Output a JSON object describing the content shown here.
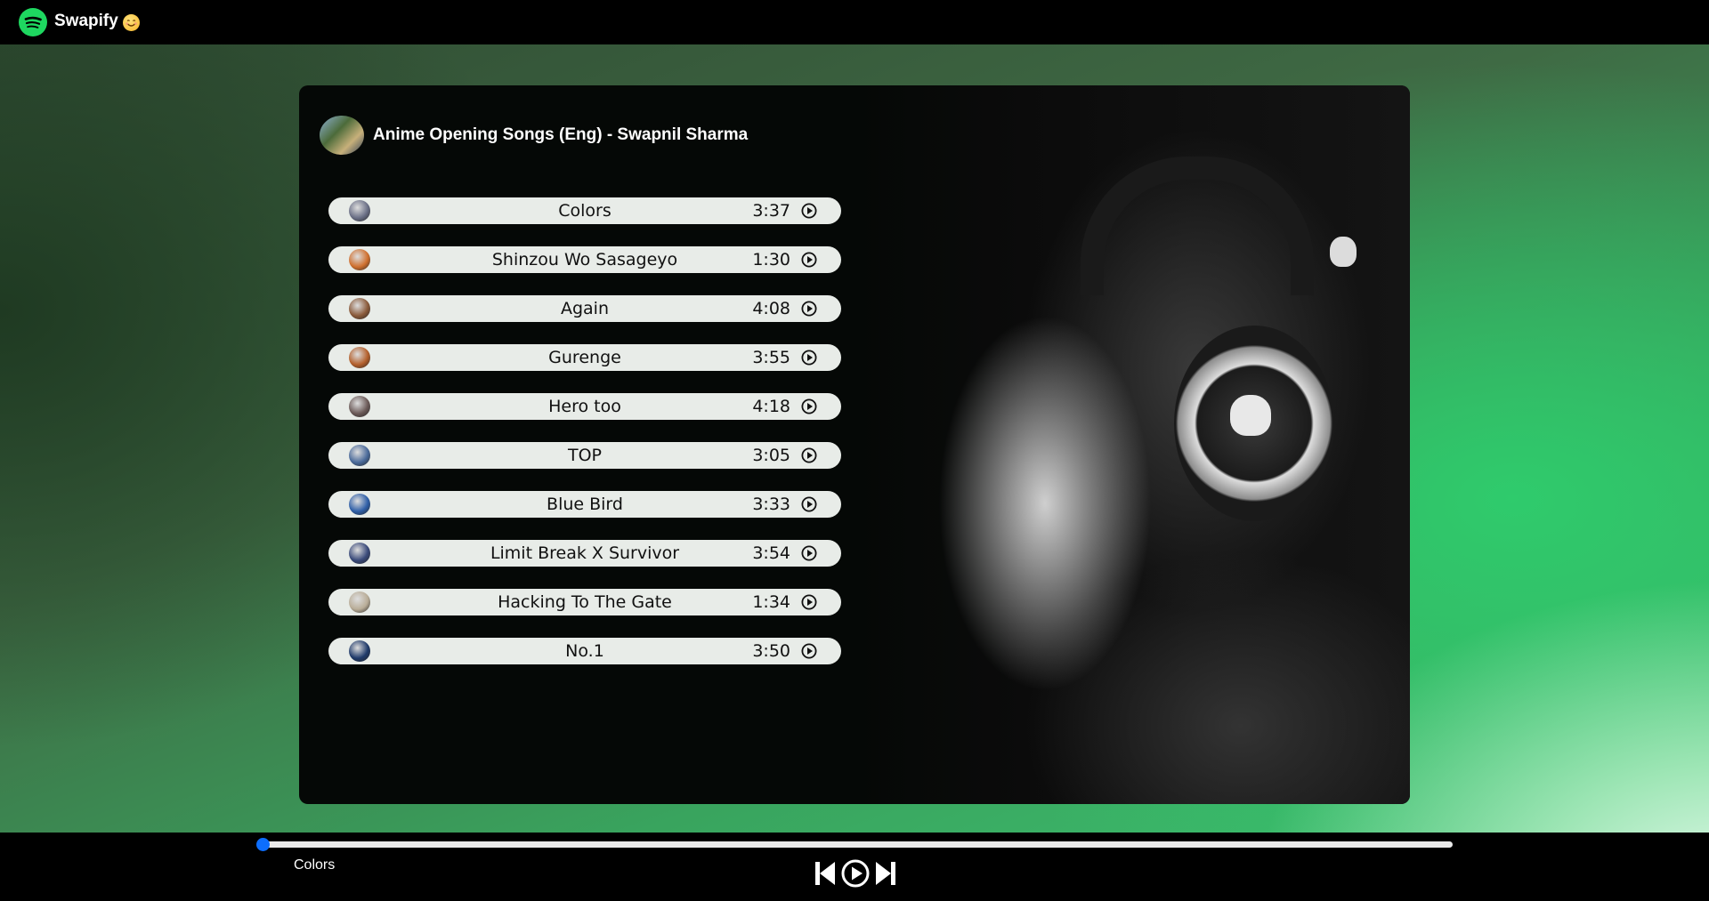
{
  "header": {
    "brand": "Swapify",
    "logo_icon": "spotify-logo-icon",
    "emoji_icon": "smiling-face-icon"
  },
  "playlist": {
    "title": "Anime Opening Songs (Eng) - Swapnil Sharma",
    "songs": [
      {
        "name": "Colors",
        "duration": "3:37",
        "thumb_color": "#6a6f86"
      },
      {
        "name": "Shinzou Wo Sasageyo",
        "duration": "1:30",
        "thumb_color": "#d0702f"
      },
      {
        "name": "Again",
        "duration": "4:08",
        "thumb_color": "#8a5a3a"
      },
      {
        "name": "Gurenge",
        "duration": "3:55",
        "thumb_color": "#b4602c"
      },
      {
        "name": "Hero too",
        "duration": "4:18",
        "thumb_color": "#6b5a58"
      },
      {
        "name": "TOP",
        "duration": "3:05",
        "thumb_color": "#4a6a9a"
      },
      {
        "name": "Blue Bird",
        "duration": "3:33",
        "thumb_color": "#2f5fa8"
      },
      {
        "name": "Limit Break X Survivor",
        "duration": "3:54",
        "thumb_color": "#3a4a7a"
      },
      {
        "name": "Hacking To The Gate",
        "duration": "1:34",
        "thumb_color": "#b9ad98"
      },
      {
        "name": "No.1",
        "duration": "3:50",
        "thumb_color": "#1f3a6a"
      }
    ]
  },
  "player": {
    "now_playing": "Colors",
    "progress": 0,
    "accent_color": "#0d6efd",
    "controls": [
      "previous-icon",
      "play-icon",
      "next-icon"
    ]
  }
}
